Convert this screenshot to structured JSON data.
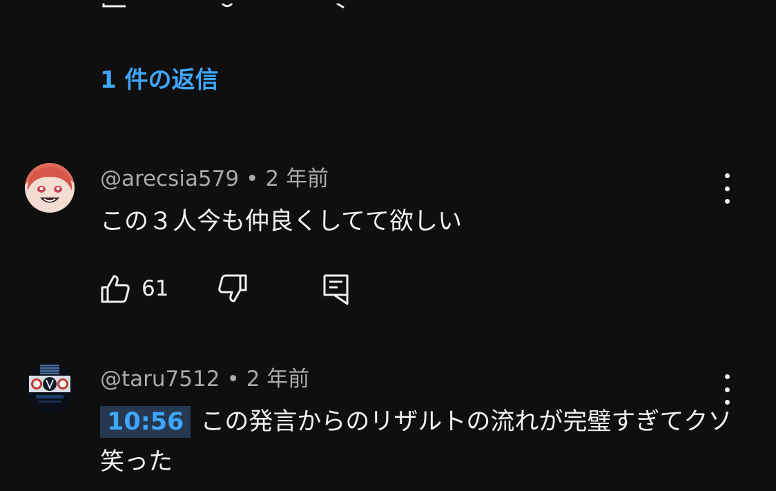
{
  "replies": {
    "label": "1 件の返信"
  },
  "comments": [
    {
      "handle": "@arecsia579",
      "separator": "•",
      "time": "2 年前",
      "text": "この３人今も仲良くしてて欲しい",
      "likes": "61",
      "avatar_icon": "anime-character-avatar"
    },
    {
      "handle": "@taru7512",
      "separator": "•",
      "time": "2 年前",
      "timestamp": "10:56",
      "text": "この発言からのリザルトの流れが完璧すぎてクソ笑った",
      "avatar_icon": "dark-logo-avatar"
    }
  ],
  "icons": {
    "like": "thumb-up-icon",
    "dislike": "thumb-down-icon",
    "reply": "reply-comment-icon",
    "more": "more-vertical-icon"
  },
  "colors": {
    "background": "#0f0f0f",
    "accent": "#3ea6ff",
    "secondary_text": "#aaaaaa",
    "primary_text": "#f1f1f1",
    "timestamp_bg": "#263850"
  }
}
